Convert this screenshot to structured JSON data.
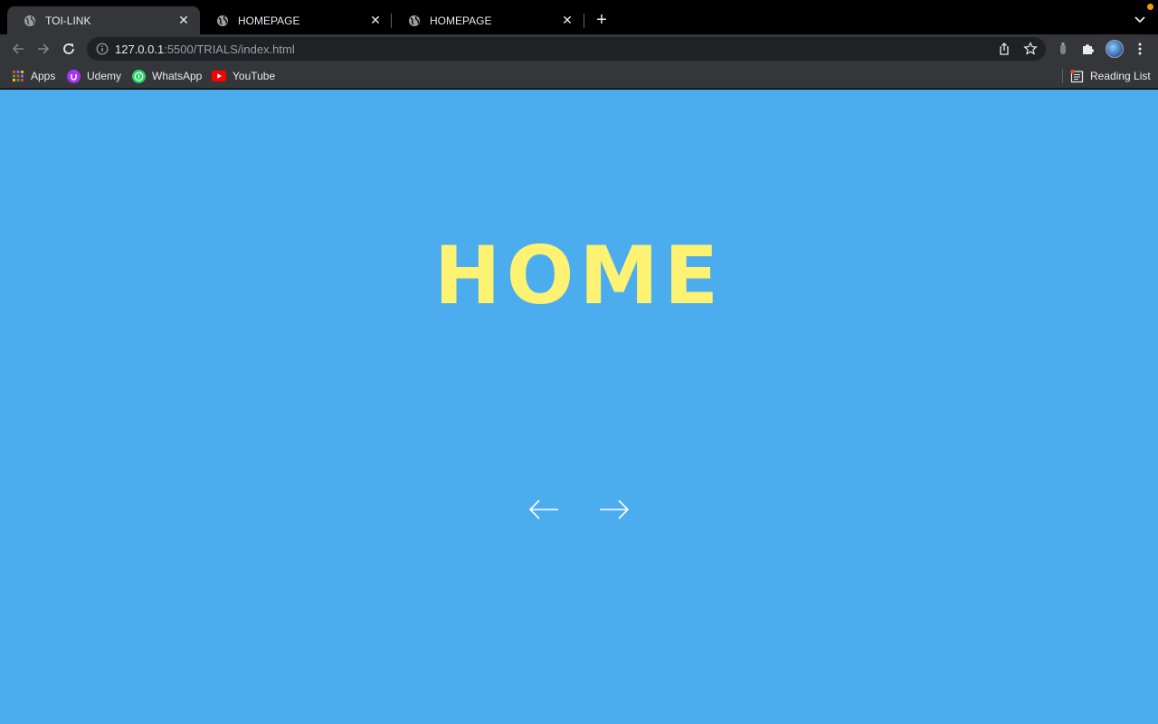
{
  "browser": {
    "tabs": [
      {
        "title": "TOI-LINK",
        "active": true
      },
      {
        "title": "HOMEPAGE",
        "active": false
      },
      {
        "title": "HOMEPAGE",
        "active": false
      }
    ],
    "address": {
      "host": "127.0.0.1",
      "path": ":5500/TRIALS/index.html"
    },
    "bookmarks": [
      {
        "label": "Apps",
        "icon": "apps-grid-icon"
      },
      {
        "label": "Udemy",
        "icon": "udemy-icon"
      },
      {
        "label": "WhatsApp",
        "icon": "whatsapp-icon"
      },
      {
        "label": "YouTube",
        "icon": "youtube-icon"
      }
    ],
    "reading_list": "Reading List"
  },
  "page": {
    "headline": "HOME",
    "background_color": "#4badee",
    "headline_color": "#fdf272",
    "prev_icon": "arrow-left-icon",
    "next_icon": "arrow-right-icon"
  }
}
